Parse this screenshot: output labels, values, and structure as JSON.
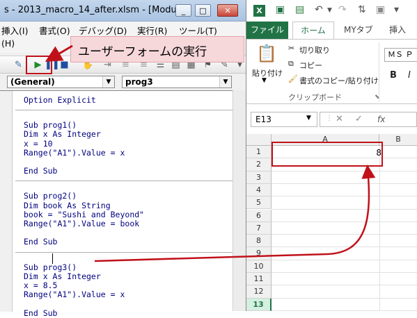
{
  "vbe": {
    "title": "s - 2013_macro_14_after.xlsm - [Modul...",
    "window_buttons": [
      "_",
      "□",
      "✕"
    ],
    "menu": [
      "挿入(I)",
      "書式(O)",
      "デバッグ(D)",
      "実行(R)",
      "ツール(T)"
    ],
    "menu2": [
      "(H)"
    ],
    "callout": "ユーザーフォームの実行",
    "combo_object": "(General)",
    "combo_proc": "prog3",
    "code_blocks": [
      [
        "Option Explicit"
      ],
      [
        "Sub prog1()",
        "Dim x As Integer",
        "x = 10",
        "Range(\"A1\").Value = x",
        "",
        "End Sub"
      ],
      [
        "Sub prog2()",
        "Dim book As String",
        "book = \"Sushi and Beyond\"",
        "Range(\"A1\").Value = book",
        "",
        "End Sub"
      ],
      [
        "Sub prog3()",
        "Dim x As Integer",
        "x = 8.5",
        "Range(\"A1\").Value = x",
        "",
        "End Sub"
      ]
    ]
  },
  "excel": {
    "tabs": [
      "ファイル",
      "ホーム",
      "MYタブ",
      "挿入"
    ],
    "ribbon": {
      "cut": "切り取り",
      "copy": "コピー",
      "paste": "貼り付け",
      "format_painter": "書式のコピー/貼り付け",
      "group": "クリップボード",
      "font_name": "ＭＳ Ｐ"
    },
    "name_box": "E13",
    "fx_label": "fx",
    "columns": [
      "A",
      "B"
    ],
    "rows": [
      "1",
      "2",
      "3",
      "4",
      "5",
      "6",
      "7",
      "8",
      "9",
      "10",
      "11",
      "12",
      "13"
    ],
    "selected_row": "13",
    "cell_a1": "8"
  },
  "colors": {
    "excel_green": "#217346",
    "highlight_red": "#c0111a",
    "code_blue": "#000080"
  }
}
